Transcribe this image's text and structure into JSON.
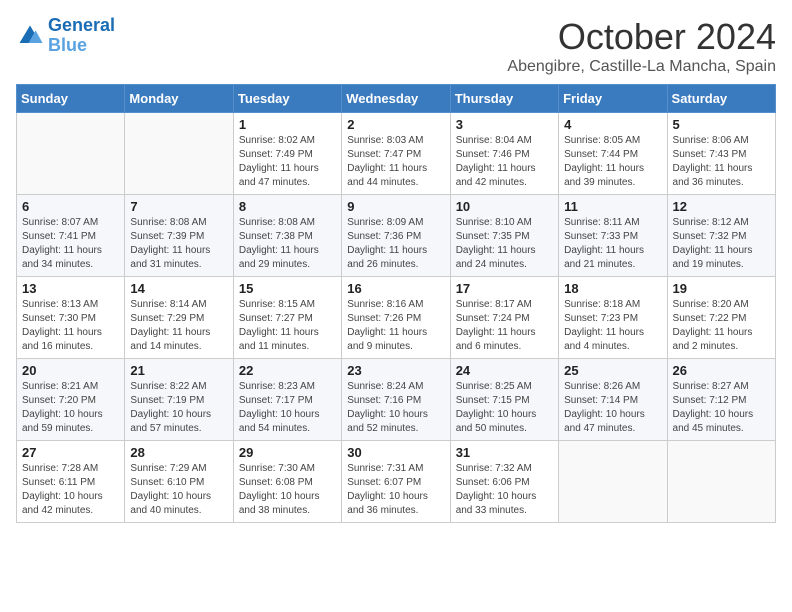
{
  "header": {
    "logo_line1": "General",
    "logo_line2": "Blue",
    "month_title": "October 2024",
    "location": "Abengibre, Castille-La Mancha, Spain"
  },
  "days_of_week": [
    "Sunday",
    "Monday",
    "Tuesday",
    "Wednesday",
    "Thursday",
    "Friday",
    "Saturday"
  ],
  "weeks": [
    [
      {
        "day": "",
        "sunrise": "",
        "sunset": "",
        "daylight": ""
      },
      {
        "day": "",
        "sunrise": "",
        "sunset": "",
        "daylight": ""
      },
      {
        "day": "1",
        "sunrise": "Sunrise: 8:02 AM",
        "sunset": "Sunset: 7:49 PM",
        "daylight": "Daylight: 11 hours and 47 minutes."
      },
      {
        "day": "2",
        "sunrise": "Sunrise: 8:03 AM",
        "sunset": "Sunset: 7:47 PM",
        "daylight": "Daylight: 11 hours and 44 minutes."
      },
      {
        "day": "3",
        "sunrise": "Sunrise: 8:04 AM",
        "sunset": "Sunset: 7:46 PM",
        "daylight": "Daylight: 11 hours and 42 minutes."
      },
      {
        "day": "4",
        "sunrise": "Sunrise: 8:05 AM",
        "sunset": "Sunset: 7:44 PM",
        "daylight": "Daylight: 11 hours and 39 minutes."
      },
      {
        "day": "5",
        "sunrise": "Sunrise: 8:06 AM",
        "sunset": "Sunset: 7:43 PM",
        "daylight": "Daylight: 11 hours and 36 minutes."
      }
    ],
    [
      {
        "day": "6",
        "sunrise": "Sunrise: 8:07 AM",
        "sunset": "Sunset: 7:41 PM",
        "daylight": "Daylight: 11 hours and 34 minutes."
      },
      {
        "day": "7",
        "sunrise": "Sunrise: 8:08 AM",
        "sunset": "Sunset: 7:39 PM",
        "daylight": "Daylight: 11 hours and 31 minutes."
      },
      {
        "day": "8",
        "sunrise": "Sunrise: 8:08 AM",
        "sunset": "Sunset: 7:38 PM",
        "daylight": "Daylight: 11 hours and 29 minutes."
      },
      {
        "day": "9",
        "sunrise": "Sunrise: 8:09 AM",
        "sunset": "Sunset: 7:36 PM",
        "daylight": "Daylight: 11 hours and 26 minutes."
      },
      {
        "day": "10",
        "sunrise": "Sunrise: 8:10 AM",
        "sunset": "Sunset: 7:35 PM",
        "daylight": "Daylight: 11 hours and 24 minutes."
      },
      {
        "day": "11",
        "sunrise": "Sunrise: 8:11 AM",
        "sunset": "Sunset: 7:33 PM",
        "daylight": "Daylight: 11 hours and 21 minutes."
      },
      {
        "day": "12",
        "sunrise": "Sunrise: 8:12 AM",
        "sunset": "Sunset: 7:32 PM",
        "daylight": "Daylight: 11 hours and 19 minutes."
      }
    ],
    [
      {
        "day": "13",
        "sunrise": "Sunrise: 8:13 AM",
        "sunset": "Sunset: 7:30 PM",
        "daylight": "Daylight: 11 hours and 16 minutes."
      },
      {
        "day": "14",
        "sunrise": "Sunrise: 8:14 AM",
        "sunset": "Sunset: 7:29 PM",
        "daylight": "Daylight: 11 hours and 14 minutes."
      },
      {
        "day": "15",
        "sunrise": "Sunrise: 8:15 AM",
        "sunset": "Sunset: 7:27 PM",
        "daylight": "Daylight: 11 hours and 11 minutes."
      },
      {
        "day": "16",
        "sunrise": "Sunrise: 8:16 AM",
        "sunset": "Sunset: 7:26 PM",
        "daylight": "Daylight: 11 hours and 9 minutes."
      },
      {
        "day": "17",
        "sunrise": "Sunrise: 8:17 AM",
        "sunset": "Sunset: 7:24 PM",
        "daylight": "Daylight: 11 hours and 6 minutes."
      },
      {
        "day": "18",
        "sunrise": "Sunrise: 8:18 AM",
        "sunset": "Sunset: 7:23 PM",
        "daylight": "Daylight: 11 hours and 4 minutes."
      },
      {
        "day": "19",
        "sunrise": "Sunrise: 8:20 AM",
        "sunset": "Sunset: 7:22 PM",
        "daylight": "Daylight: 11 hours and 2 minutes."
      }
    ],
    [
      {
        "day": "20",
        "sunrise": "Sunrise: 8:21 AM",
        "sunset": "Sunset: 7:20 PM",
        "daylight": "Daylight: 10 hours and 59 minutes."
      },
      {
        "day": "21",
        "sunrise": "Sunrise: 8:22 AM",
        "sunset": "Sunset: 7:19 PM",
        "daylight": "Daylight: 10 hours and 57 minutes."
      },
      {
        "day": "22",
        "sunrise": "Sunrise: 8:23 AM",
        "sunset": "Sunset: 7:17 PM",
        "daylight": "Daylight: 10 hours and 54 minutes."
      },
      {
        "day": "23",
        "sunrise": "Sunrise: 8:24 AM",
        "sunset": "Sunset: 7:16 PM",
        "daylight": "Daylight: 10 hours and 52 minutes."
      },
      {
        "day": "24",
        "sunrise": "Sunrise: 8:25 AM",
        "sunset": "Sunset: 7:15 PM",
        "daylight": "Daylight: 10 hours and 50 minutes."
      },
      {
        "day": "25",
        "sunrise": "Sunrise: 8:26 AM",
        "sunset": "Sunset: 7:14 PM",
        "daylight": "Daylight: 10 hours and 47 minutes."
      },
      {
        "day": "26",
        "sunrise": "Sunrise: 8:27 AM",
        "sunset": "Sunset: 7:12 PM",
        "daylight": "Daylight: 10 hours and 45 minutes."
      }
    ],
    [
      {
        "day": "27",
        "sunrise": "Sunrise: 7:28 AM",
        "sunset": "Sunset: 6:11 PM",
        "daylight": "Daylight: 10 hours and 42 minutes."
      },
      {
        "day": "28",
        "sunrise": "Sunrise: 7:29 AM",
        "sunset": "Sunset: 6:10 PM",
        "daylight": "Daylight: 10 hours and 40 minutes."
      },
      {
        "day": "29",
        "sunrise": "Sunrise: 7:30 AM",
        "sunset": "Sunset: 6:08 PM",
        "daylight": "Daylight: 10 hours and 38 minutes."
      },
      {
        "day": "30",
        "sunrise": "Sunrise: 7:31 AM",
        "sunset": "Sunset: 6:07 PM",
        "daylight": "Daylight: 10 hours and 36 minutes."
      },
      {
        "day": "31",
        "sunrise": "Sunrise: 7:32 AM",
        "sunset": "Sunset: 6:06 PM",
        "daylight": "Daylight: 10 hours and 33 minutes."
      },
      {
        "day": "",
        "sunrise": "",
        "sunset": "",
        "daylight": ""
      },
      {
        "day": "",
        "sunrise": "",
        "sunset": "",
        "daylight": ""
      }
    ]
  ]
}
